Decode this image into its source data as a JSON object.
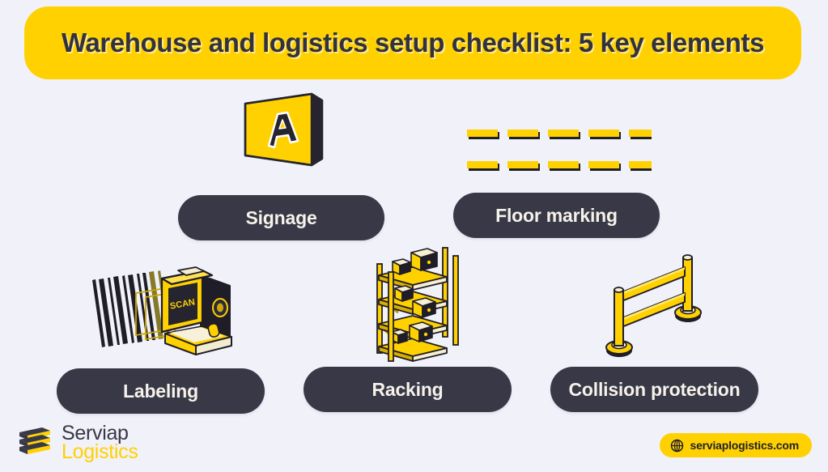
{
  "page": {
    "background_color": "#f1f1fa",
    "accent_yellow": "#ffd100",
    "dark_navy": "#383846",
    "cream_text": "#f6f2ea"
  },
  "header": {
    "title": "Warehouse and logistics setup checklist: 5 key elements",
    "background_color": "#ffd100",
    "text_color": "#32323f"
  },
  "elements": [
    {
      "id": "signage",
      "label": "Signage",
      "icon_name": "signage-board-icon",
      "icon_text": "A"
    },
    {
      "id": "floor_marking",
      "label": "Floor marking",
      "icon_name": "floor-marking-dashes-icon",
      "dash_rows": 2,
      "dashes_per_row": 5
    },
    {
      "id": "labeling",
      "label": "Labeling",
      "icon_name": "barcode-scanner-icon",
      "icon_text": "SCAN"
    },
    {
      "id": "racking",
      "label": "Racking",
      "icon_name": "pallet-racking-icon",
      "shelf_count": 4
    },
    {
      "id": "collision_protection",
      "label": "Collision protection",
      "icon_name": "guardrail-icon",
      "rail_count": 2
    }
  ],
  "footer": {
    "logo": {
      "icon_name": "serviap-stacked-bars-logo-icon",
      "word_top": "Serviap",
      "word_bottom": "Logistics",
      "word_top_color": "#383846",
      "word_bottom_color": "#ffd100"
    },
    "website_badge": {
      "icon_name": "globe-icon",
      "text": "serviaplogistics.com",
      "background_color": "#ffd100",
      "text_color": "#22222c"
    }
  }
}
